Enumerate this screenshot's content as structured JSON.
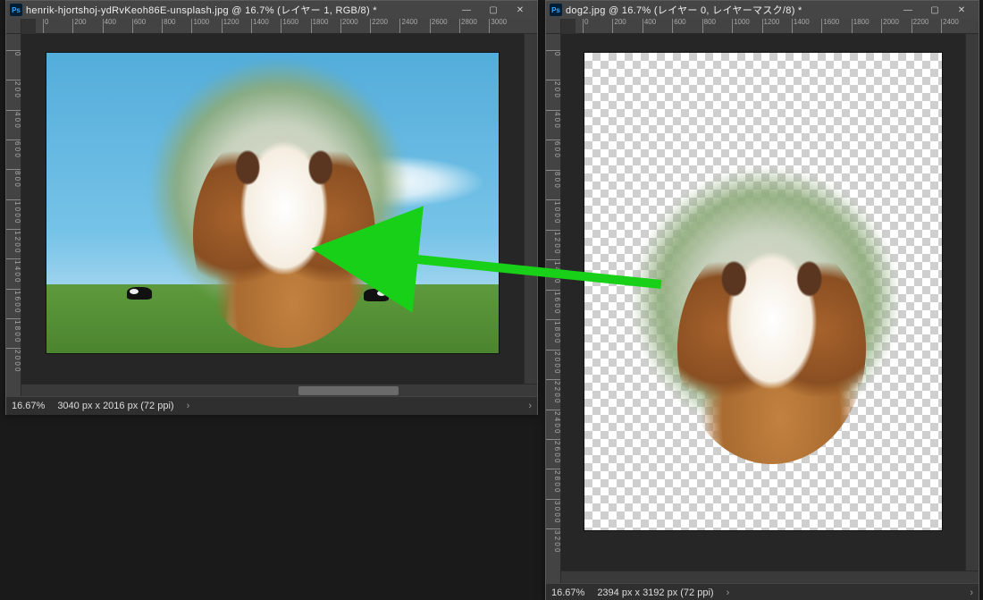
{
  "windows": [
    {
      "id": "w1",
      "title": "henrik-hjortshoj-ydRvKeoh86E-unsplash.jpg @ 16.7% (レイヤー 1, RGB/8) *",
      "titlebar_annotation_star": "*",
      "ruler_h_ticks": [
        "0",
        "200",
        "400",
        "600",
        "800",
        "1000",
        "1200",
        "1400",
        "1600",
        "1800",
        "2000",
        "2200",
        "2400",
        "2600",
        "2800",
        "3000"
      ],
      "ruler_v_ticks": [
        "0",
        "200",
        "400",
        "600",
        "800",
        "1000",
        "1200",
        "1400",
        "1600",
        "1800",
        "2000"
      ],
      "status_zoom": "16.67%",
      "status_dims": "3040 px x 2016 px (72 ppi)",
      "win_btn_min": "—",
      "win_btn_max": "▢",
      "win_btn_close": "✕",
      "chevron": "›"
    },
    {
      "id": "w2",
      "title": "dog2.jpg @ 16.7% (レイヤー 0, レイヤーマスク/8) *",
      "titlebar_annotation_star": "*",
      "ruler_h_ticks": [
        "0",
        "200",
        "400",
        "600",
        "800",
        "1000",
        "1200",
        "1400",
        "1600",
        "1800",
        "2000",
        "2200",
        "2400"
      ],
      "ruler_v_ticks": [
        "0",
        "200",
        "400",
        "600",
        "800",
        "1000",
        "1200",
        "1400",
        "1600",
        "1800",
        "2000",
        "2200",
        "2400",
        "2600",
        "2800",
        "3000",
        "3200"
      ],
      "status_zoom": "16.67%",
      "status_dims": "2394 px x 3192 px (72 ppi)",
      "win_btn_min": "—",
      "win_btn_max": "▢",
      "win_btn_close": "✕",
      "chevron": "›"
    }
  ],
  "arrow": {
    "color": "#17d017",
    "from": "window-2-canvas",
    "to": "window-1-canvas"
  }
}
